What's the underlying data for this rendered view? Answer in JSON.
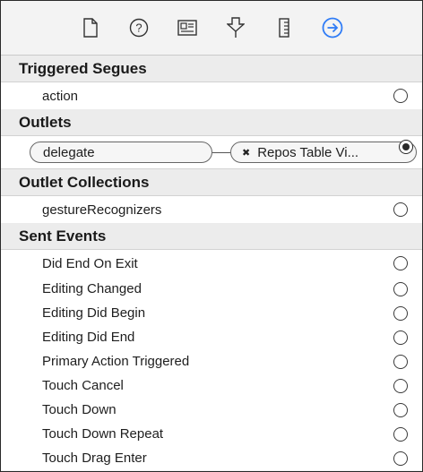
{
  "toolbar": {
    "icons": [
      {
        "name": "file-inspector-icon"
      },
      {
        "name": "quick-help-icon"
      },
      {
        "name": "identity-inspector-icon"
      },
      {
        "name": "attributes-inspector-icon"
      },
      {
        "name": "size-inspector-icon"
      },
      {
        "name": "connections-inspector-icon",
        "active": true,
        "color": "#2f7cf6"
      }
    ]
  },
  "sections": {
    "triggered_segues": {
      "title": "Triggered Segues",
      "rows": [
        "action"
      ]
    },
    "outlets": {
      "title": "Outlets",
      "outlet_name": "delegate",
      "target_x": "✖",
      "target_name": "Repos Table Vi..."
    },
    "outlet_collections": {
      "title": "Outlet Collections",
      "rows": [
        "gestureRecognizers"
      ]
    },
    "sent_events": {
      "title": "Sent Events",
      "rows": [
        "Did End On Exit",
        "Editing Changed",
        "Editing Did Begin",
        "Editing Did End",
        "Primary Action Triggered",
        "Touch Cancel",
        "Touch Down",
        "Touch Down Repeat",
        "Touch Drag Enter"
      ]
    }
  },
  "colors": {
    "accent": "#2f7cf6"
  }
}
